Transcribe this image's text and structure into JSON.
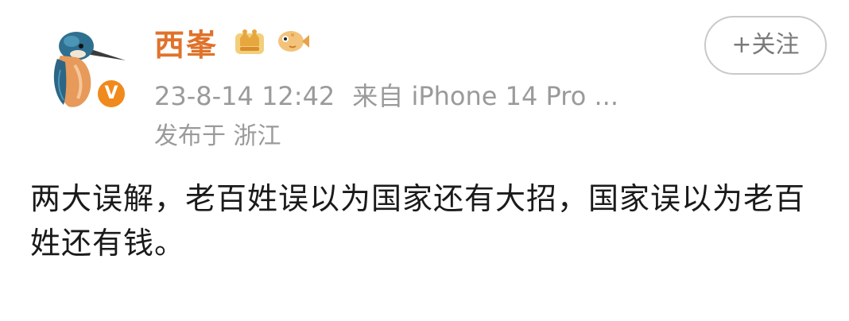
{
  "post": {
    "author": {
      "name": "西峯",
      "avatar_icon": "kingfisher-avatar-icon",
      "verified_badge_label": "V",
      "badges": [
        "crown-badge-icon",
        "fish-badge-icon"
      ]
    },
    "meta": {
      "time": "23-8-14 12:42",
      "source": "来自 iPhone 14 Pro ...",
      "location": "发布于 浙江"
    },
    "follow_label": "+关注",
    "content": "两大误解，老百姓误以为国家还有大招，国家误以为老百姓还有钱。"
  },
  "colors": {
    "username": "#e0722a",
    "meta": "#9a9a9a",
    "verified": "#f08a1c",
    "text": "#1a1a1a"
  }
}
